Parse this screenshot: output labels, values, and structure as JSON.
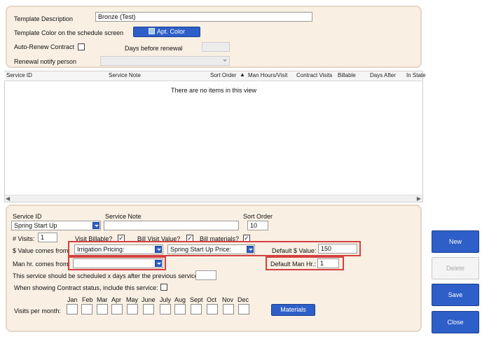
{
  "header": {
    "template_description_label": "Template Description",
    "template_description_value": "Bronze (Test)",
    "template_color_label": "Template Color on the schedule screen",
    "apt_color_button": "Apt. Color",
    "auto_renew_label": "Auto-Renew Contract",
    "days_before_renewal_label": "Days before renewal",
    "renewal_notify_label": "Renewal notify person"
  },
  "grid": {
    "columns": [
      "Service ID",
      "Service Note",
      "Sort Order",
      "Man Hours/Visit",
      "Contract Visits",
      "Billable",
      "Days After",
      "In State"
    ],
    "empty_text": "There are no items in this view"
  },
  "details": {
    "service_id_label": "Service ID",
    "service_id_value": "Spring Start Up",
    "service_note_label": "Service Note",
    "sort_order_label": "Sort Order",
    "sort_order_value": "10",
    "visits_label": "# Visits:",
    "visits_value": "1",
    "visit_billable_label": "Visit Billable?",
    "bill_visit_value_label": "Bill Visit Value?",
    "bill_materials_label": "Bill materials?",
    "value_comes_from_label": "$ Value comes from:",
    "value_source_1": "Irrigation Pricing:",
    "value_source_2": "Spring Start Up Price:",
    "default_value_label": "Default $ Value:",
    "default_value": "150",
    "man_hr_comes_from_label": "Man hr. comes from:",
    "default_man_hr_label": "Default Man Hr.:",
    "default_man_hr_value": "1",
    "schedule_days_label": "This service should be scheduled x days after the previous service:",
    "contract_status_label": "When showing Contract status, include this service:",
    "visits_per_month_label": "Visits per month:",
    "months": [
      "Jan",
      "Feb",
      "Mar",
      "Apr",
      "May",
      "June",
      "July",
      "Aug",
      "Sept",
      "Oct",
      "Nov",
      "Dec"
    ],
    "materials_button": "Materials"
  },
  "side_buttons": {
    "new": "New",
    "delete": "Delete",
    "save": "Save",
    "close": "Close"
  },
  "colors": {
    "accent": "#2e5fc8",
    "panel": "#f9efe3",
    "highlight": "#d44040"
  }
}
